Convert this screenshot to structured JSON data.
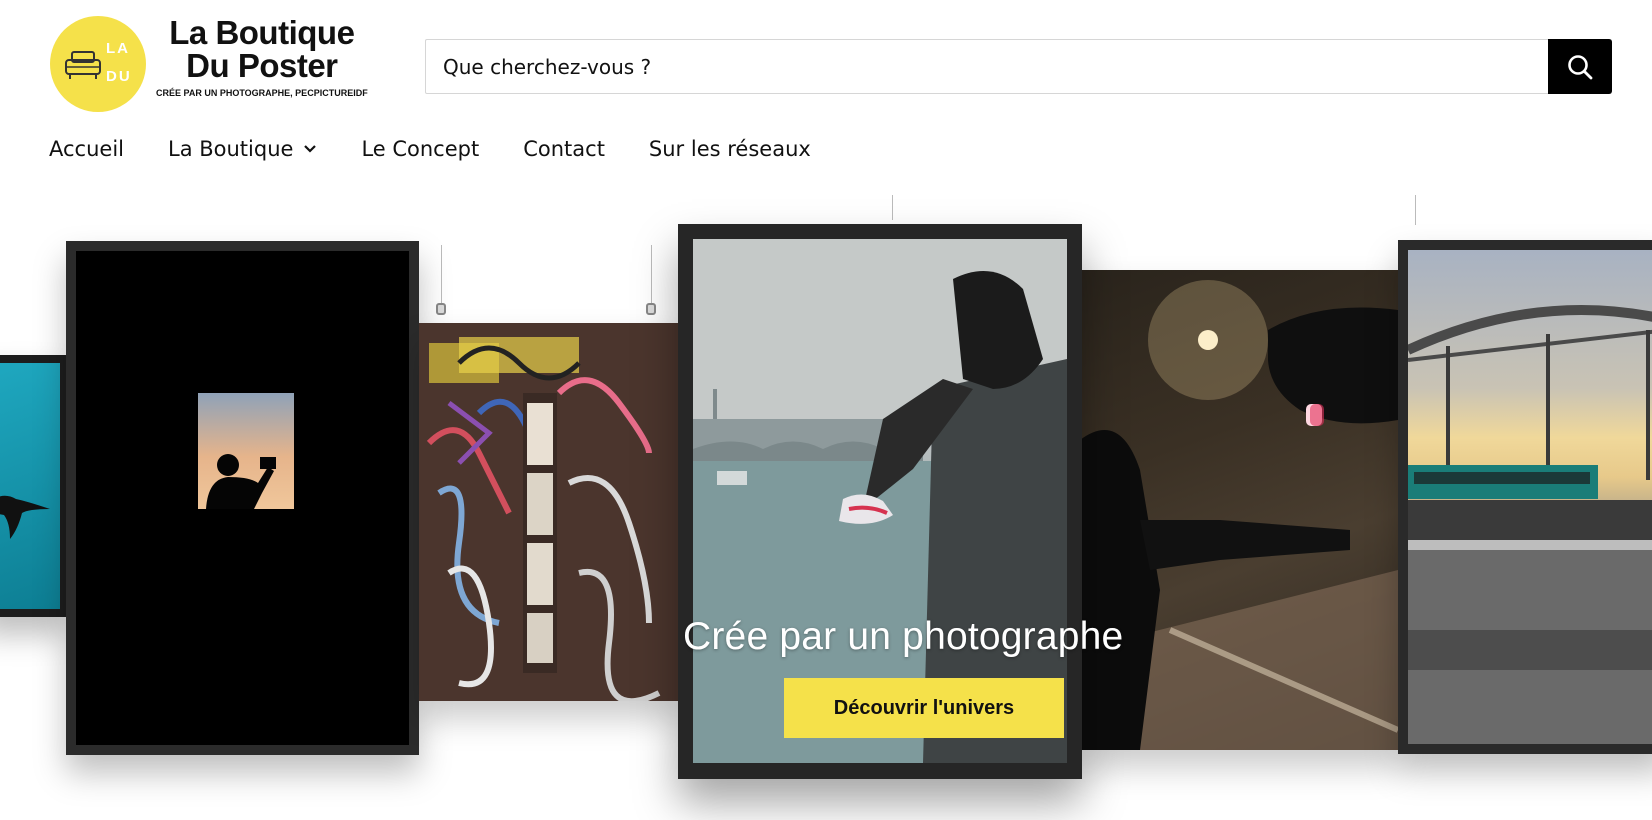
{
  "brand": {
    "logo_letters_top": "LA",
    "logo_letters_bottom": "DU",
    "title_line1": "La Boutique",
    "title_line2": "Du Poster",
    "subtitle": "CRÉE PAR UN PHOTOGRAPHE, PECPICTUREIDF",
    "accent_color": "#f5e14a"
  },
  "search": {
    "placeholder": "Que cherchez-vous ?",
    "value": "",
    "icon": "search-icon"
  },
  "nav": {
    "items": [
      {
        "label": "Accueil"
      },
      {
        "label": "La Boutique",
        "has_dropdown": true,
        "icon": "chevron-down-icon"
      },
      {
        "label": "Le Concept"
      },
      {
        "label": "Contact"
      },
      {
        "label": "Sur les réseaux"
      }
    ]
  },
  "hero": {
    "title": "Crée par un photographe",
    "cta_label": "Découvrir l'univers",
    "cta_color": "#f5e14a"
  }
}
